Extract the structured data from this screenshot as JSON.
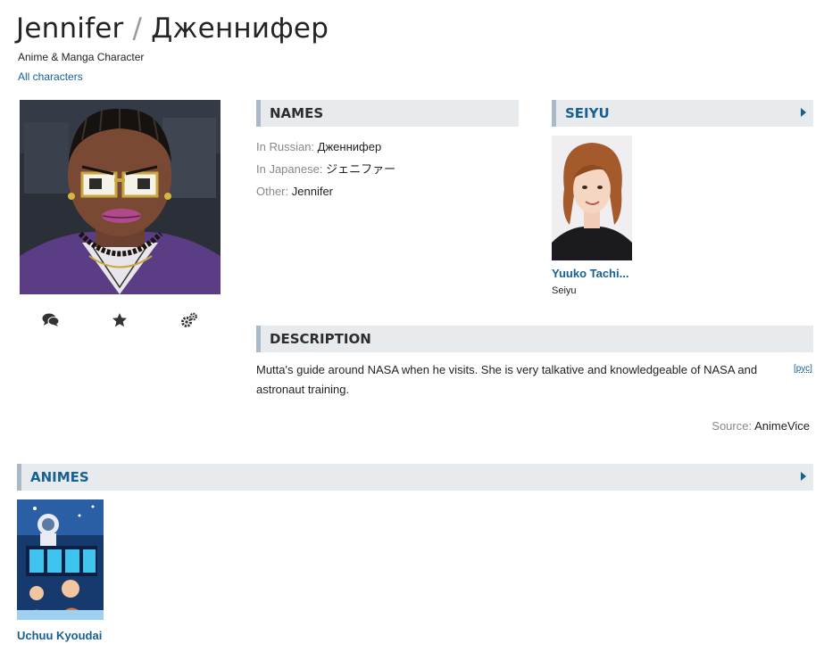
{
  "header": {
    "title_en": "Jennifer",
    "separator": "/",
    "title_ru": "Дженнифер",
    "subtitle": "Anime & Manga Character",
    "all_characters_link": "All characters"
  },
  "actions": {
    "icons": [
      "comments-icon",
      "star-icon",
      "gears-icon"
    ]
  },
  "names": {
    "heading": "NAMES",
    "russian_label": "In Russian:",
    "russian_value": "Дженнифер",
    "japanese_label": "In Japanese:",
    "japanese_value": "ジェニファー",
    "other_label": "Other:",
    "other_value": "Jennifer"
  },
  "seiyu": {
    "heading": "SEIYU",
    "name": "Yuuko Tachi...",
    "role": "Seiyu"
  },
  "description": {
    "heading": "DESCRIPTION",
    "text": "Mutta's guide around NASA when he visits. She is very talkative and knowledgeable of NASA and astronaut training.",
    "lang_link": "[рус]",
    "source_label": "Source:",
    "source_value": "AnimeVice"
  },
  "animes": {
    "heading": "ANIMES",
    "items": [
      {
        "name": "Uchuu Kyoudai"
      }
    ]
  },
  "colors": {
    "link": "#176093",
    "section_bg": "#e8ebee",
    "section_border": "#a9b9c8",
    "muted": "#888888"
  }
}
